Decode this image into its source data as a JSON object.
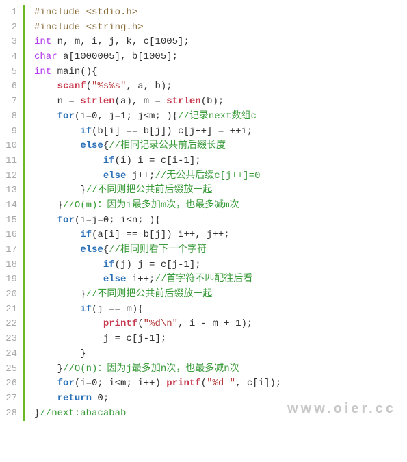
{
  "watermark": "www.oier.cc",
  "line_numbers": [
    "1",
    "2",
    "3",
    "4",
    "5",
    "6",
    "7",
    "8",
    "9",
    "10",
    "11",
    "12",
    "13",
    "14",
    "15",
    "16",
    "17",
    "18",
    "19",
    "20",
    "21",
    "22",
    "23",
    "24",
    "25",
    "26",
    "27",
    "28"
  ],
  "code": {
    "lines": [
      {
        "indent": "",
        "tokens": [
          {
            "cls": "pp",
            "t": "#include <stdio.h>"
          }
        ]
      },
      {
        "indent": "",
        "tokens": [
          {
            "cls": "pp",
            "t": "#include <string.h>"
          }
        ]
      },
      {
        "indent": "",
        "tokens": [
          {
            "cls": "ty",
            "t": "int"
          },
          {
            "cls": "id",
            "t": " n, m, i, j, k, c[1005];"
          }
        ]
      },
      {
        "indent": "",
        "tokens": [
          {
            "cls": "ty",
            "t": "char"
          },
          {
            "cls": "id",
            "t": " a[1000005], b[1005];"
          }
        ]
      },
      {
        "indent": "",
        "tokens": [
          {
            "cls": "ty",
            "t": "int"
          },
          {
            "cls": "id",
            "t": " main(){"
          }
        ]
      },
      {
        "indent": "    ",
        "tokens": [
          {
            "cls": "fn",
            "t": "scanf"
          },
          {
            "cls": "id",
            "t": "("
          },
          {
            "cls": "str",
            "t": "\"%s%s\""
          },
          {
            "cls": "id",
            "t": ", a, b);"
          }
        ]
      },
      {
        "indent": "    ",
        "tokens": [
          {
            "cls": "id",
            "t": "n = "
          },
          {
            "cls": "fn",
            "t": "strlen"
          },
          {
            "cls": "id",
            "t": "(a), m = "
          },
          {
            "cls": "fn",
            "t": "strlen"
          },
          {
            "cls": "id",
            "t": "(b);"
          }
        ]
      },
      {
        "indent": "    ",
        "tokens": [
          {
            "cls": "kw",
            "t": "for"
          },
          {
            "cls": "id",
            "t": "(i=0, j=1; j<m; ){"
          },
          {
            "cls": "cm",
            "t": "//记录next数组c"
          }
        ]
      },
      {
        "indent": "        ",
        "tokens": [
          {
            "cls": "kw",
            "t": "if"
          },
          {
            "cls": "id",
            "t": "(b[i] == b[j]) c[j++] = ++i;"
          }
        ]
      },
      {
        "indent": "        ",
        "tokens": [
          {
            "cls": "kw",
            "t": "else"
          },
          {
            "cls": "id",
            "t": "{"
          },
          {
            "cls": "cm",
            "t": "//相同记录公共前后缀长度"
          }
        ]
      },
      {
        "indent": "            ",
        "tokens": [
          {
            "cls": "kw",
            "t": "if"
          },
          {
            "cls": "id",
            "t": "(i) i = c[i-1];"
          }
        ]
      },
      {
        "indent": "            ",
        "tokens": [
          {
            "cls": "kw",
            "t": "else"
          },
          {
            "cls": "id",
            "t": " j++;"
          },
          {
            "cls": "cm",
            "t": "//无公共后缀c[j++]=0"
          }
        ]
      },
      {
        "indent": "        ",
        "tokens": [
          {
            "cls": "id",
            "t": "}"
          },
          {
            "cls": "cm",
            "t": "//不同则把公共前后缀放一起"
          }
        ]
      },
      {
        "indent": "    ",
        "tokens": [
          {
            "cls": "id",
            "t": "}"
          },
          {
            "cls": "cm",
            "t": "//O(m)：因为i最多加m次，也最多减m次"
          }
        ]
      },
      {
        "indent": "    ",
        "tokens": [
          {
            "cls": "kw",
            "t": "for"
          },
          {
            "cls": "id",
            "t": "(i=j=0; i<n; ){"
          }
        ]
      },
      {
        "indent": "        ",
        "tokens": [
          {
            "cls": "kw",
            "t": "if"
          },
          {
            "cls": "id",
            "t": "(a[i] == b[j]) i++, j++;"
          }
        ]
      },
      {
        "indent": "        ",
        "tokens": [
          {
            "cls": "kw",
            "t": "else"
          },
          {
            "cls": "id",
            "t": "{"
          },
          {
            "cls": "cm",
            "t": "//相同则看下一个字符"
          }
        ]
      },
      {
        "indent": "            ",
        "tokens": [
          {
            "cls": "kw",
            "t": "if"
          },
          {
            "cls": "id",
            "t": "(j) j = c[j-1];"
          }
        ]
      },
      {
        "indent": "            ",
        "tokens": [
          {
            "cls": "kw",
            "t": "else"
          },
          {
            "cls": "id",
            "t": " i++;"
          },
          {
            "cls": "cm",
            "t": "//首字符不匹配往后看"
          }
        ]
      },
      {
        "indent": "        ",
        "tokens": [
          {
            "cls": "id",
            "t": "}"
          },
          {
            "cls": "cm",
            "t": "//不同则把公共前后缀放一起"
          }
        ]
      },
      {
        "indent": "        ",
        "tokens": [
          {
            "cls": "kw",
            "t": "if"
          },
          {
            "cls": "id",
            "t": "(j == m){"
          }
        ]
      },
      {
        "indent": "            ",
        "tokens": [
          {
            "cls": "fn",
            "t": "printf"
          },
          {
            "cls": "id",
            "t": "("
          },
          {
            "cls": "str",
            "t": "\"%d\\n\""
          },
          {
            "cls": "id",
            "t": ", i - m + 1);"
          }
        ]
      },
      {
        "indent": "            ",
        "tokens": [
          {
            "cls": "id",
            "t": "j = c[j-1];"
          }
        ]
      },
      {
        "indent": "        ",
        "tokens": [
          {
            "cls": "id",
            "t": "}"
          }
        ]
      },
      {
        "indent": "    ",
        "tokens": [
          {
            "cls": "id",
            "t": "}"
          },
          {
            "cls": "cm",
            "t": "//O(n)：因为j最多加n次，也最多减n次"
          }
        ]
      },
      {
        "indent": "    ",
        "tokens": [
          {
            "cls": "kw",
            "t": "for"
          },
          {
            "cls": "id",
            "t": "(i=0; i<m; i++) "
          },
          {
            "cls": "fn",
            "t": "printf"
          },
          {
            "cls": "id",
            "t": "("
          },
          {
            "cls": "str",
            "t": "\"%d \""
          },
          {
            "cls": "id",
            "t": ", c[i]);"
          }
        ]
      },
      {
        "indent": "    ",
        "tokens": [
          {
            "cls": "kw",
            "t": "return"
          },
          {
            "cls": "id",
            "t": " 0;"
          }
        ]
      },
      {
        "indent": "",
        "tokens": [
          {
            "cls": "id",
            "t": "}"
          },
          {
            "cls": "cm",
            "t": "//next:abacabab"
          }
        ]
      }
    ]
  }
}
